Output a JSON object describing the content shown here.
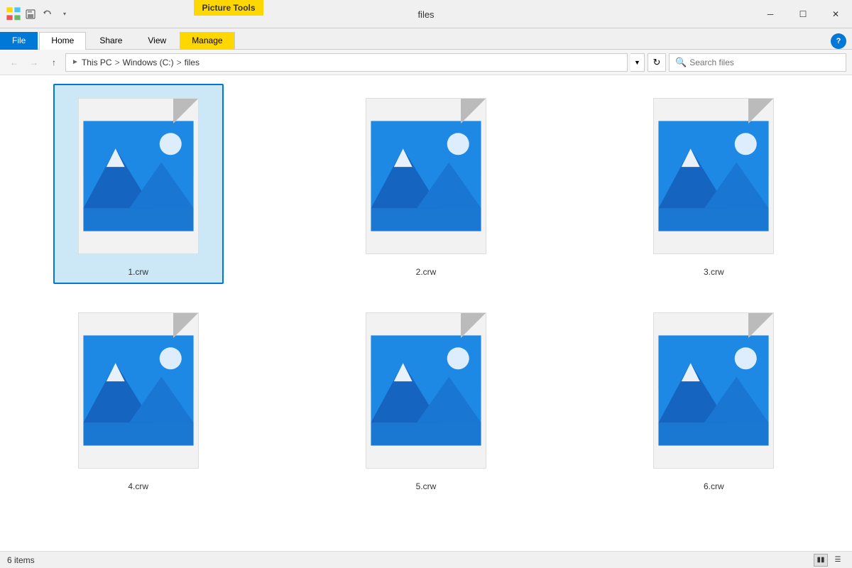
{
  "titleBar": {
    "pictureTools": "Picture Tools",
    "title": "files",
    "minimizeTitle": "Minimize",
    "maximizeTitle": "Maximize",
    "closeTitle": "Close"
  },
  "ribbon": {
    "tabs": [
      "File",
      "Home",
      "Share",
      "View",
      "Manage"
    ],
    "fileTab": "File",
    "homeTab": "Home",
    "shareTab": "Share",
    "viewTab": "View",
    "manageTab": "Manage",
    "helpLabel": "?"
  },
  "addressBar": {
    "thisPc": "This PC",
    "windowsC": "Windows (C:)",
    "files": "files",
    "refreshTitle": "Refresh",
    "searchPlaceholder": "Search files"
  },
  "files": [
    {
      "name": "1.crw",
      "selected": true
    },
    {
      "name": "2.crw",
      "selected": false
    },
    {
      "name": "3.crw",
      "selected": false
    },
    {
      "name": "4.crw",
      "selected": false
    },
    {
      "name": "5.crw",
      "selected": false
    },
    {
      "name": "6.crw",
      "selected": false
    }
  ],
  "statusBar": {
    "itemCount": "6 items"
  }
}
